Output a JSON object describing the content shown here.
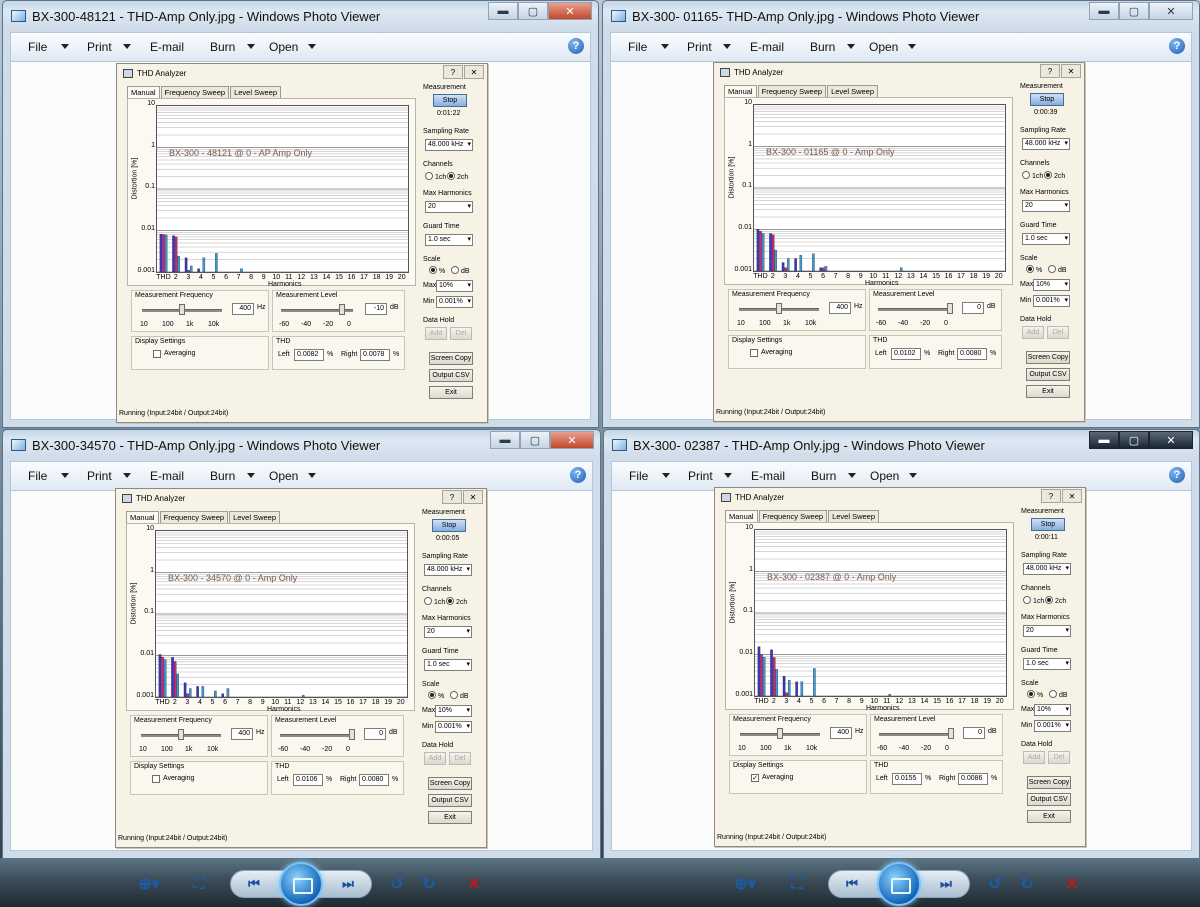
{
  "menu": {
    "file": "File",
    "print": "Print",
    "email": "E-mail",
    "burn": "Burn",
    "open": "Open",
    "help_icon": "?"
  },
  "caption_glyphs": {
    "minimize": "▬",
    "maximize": "▢",
    "close": "✕"
  },
  "dialog": {
    "title": "THD Analyzer",
    "title_buttons": [
      "?",
      "✕"
    ],
    "tabs": [
      "Manual",
      "Frequency Sweep",
      "Level Sweep"
    ],
    "y_axis_label": "Distortion [%]",
    "y_ticks": [
      "10",
      "1",
      "0.1",
      "0.01",
      "0.001"
    ],
    "x_ticks": [
      "THD",
      "2",
      "3",
      "4",
      "5",
      "6",
      "7",
      "8",
      "9",
      "10",
      "11",
      "12",
      "13",
      "14",
      "15",
      "16",
      "17",
      "18",
      "19",
      "20"
    ],
    "x_axis_label": "Harmonics",
    "measurement_frequency_label": "Measurement Frequency",
    "frequency_ticks": [
      "10",
      "100",
      "1k",
      "10k"
    ],
    "frequency_unit": "Hz",
    "measurement_level_label": "Measurement Level",
    "level_ticks": [
      "-60",
      "-40",
      "-20",
      "0"
    ],
    "level_unit": "dB",
    "display_settings_label": "Display Settings",
    "averaging_label": "Averaging",
    "thd_label": "THD",
    "left_label": "Left",
    "right_label": "Right",
    "percent": "%",
    "measurement_label": "Measurement",
    "stop_label": "Stop",
    "sampling_rate_label": "Sampling Rate",
    "sampling_rate_value": "48.000 kHz",
    "channels_label": "Channels",
    "ch1_label": "1ch",
    "ch2_label": "2ch",
    "max_harmonics_label": "Max Harmonics",
    "max_harmonics_value": "20",
    "guard_time_label": "Guard Time",
    "guard_time_value": "1.0 sec",
    "scale_label": "Scale",
    "scale_pct": "%",
    "scale_db": "dB",
    "max_label": "Max",
    "max_value": "10%",
    "min_label": "Min",
    "min_value": "0.001%",
    "data_hold_label": "Data Hold",
    "add_label": "Add",
    "del_label": "Del",
    "screen_copy_label": "Screen Copy",
    "output_csv_label": "Output CSV",
    "exit_label": "Exit",
    "status": "Running (Input:24bit / Output:24bit)"
  },
  "windows": [
    {
      "title": "BX-300-48121 - THD-Amp Only.jpg - Windows Photo Viewer",
      "timer": "0:01:22",
      "annotation": "BX-300 - 48121 @ 0 - AP Amp Only",
      "frequency_value": "400",
      "level_value": "-10",
      "level_knob": 0.85,
      "thd_left": "0.0082",
      "thd_right": "0.0078",
      "averaging_checked": false,
      "chart_data": {
        "type": "bar",
        "categories": [
          "THD",
          "2",
          "3",
          "4",
          "5",
          "6",
          "7",
          "8",
          "9",
          "10",
          "11",
          "12",
          "13",
          "14",
          "15",
          "16",
          "17",
          "18",
          "19",
          "20"
        ],
        "series": [
          {
            "color": "#3a35c8",
            "values": [
              0.0082,
              0.0075,
              0.0022,
              0.0012,
              0,
              0,
              0,
              0,
              0,
              0,
              0,
              0,
              0,
              0,
              0,
              0,
              0,
              0,
              0,
              0
            ]
          },
          {
            "color": "#c8277a",
            "values": [
              0.008,
              0.007,
              0.0011,
              0,
              0,
              0,
              0,
              0,
              0,
              0,
              0,
              0,
              0,
              0,
              0,
              0,
              0,
              0,
              0,
              0
            ]
          },
          {
            "color": "#3a9ad8",
            "values": [
              0.0078,
              0.0024,
              0.0014,
              0.0022,
              0.0028,
              0,
              0.0012,
              0,
              0,
              0,
              0,
              0,
              0,
              0,
              0,
              0,
              0,
              0,
              0,
              0
            ]
          }
        ],
        "ylim": [
          0.001,
          10
        ],
        "yscale": "log"
      }
    },
    {
      "title": "BX-300- 01165- THD-Amp Only.jpg - Windows Photo Viewer",
      "timer": "0:00:39",
      "annotation": "BX-300 - 01165 @ 0 - Amp Only",
      "frequency_value": "400",
      "level_value": "0",
      "level_knob": 1.0,
      "thd_left": "0.0102",
      "thd_right": "0.0080",
      "averaging_checked": false,
      "chart_data": {
        "type": "bar",
        "categories": [
          "THD",
          "2",
          "3",
          "4",
          "5",
          "6",
          "7",
          "8",
          "9",
          "10",
          "11",
          "12",
          "13",
          "14",
          "15",
          "16",
          "17",
          "18",
          "19",
          "20"
        ],
        "series": [
          {
            "color": "#3a35c8",
            "values": [
              0.0102,
              0.008,
              0.0016,
              0.002,
              0,
              0.0012,
              0,
              0,
              0,
              0,
              0,
              0,
              0,
              0,
              0,
              0,
              0,
              0,
              0,
              0
            ]
          },
          {
            "color": "#c8277a",
            "values": [
              0.009,
              0.0075,
              0.0012,
              0,
              0,
              0.0012,
              0,
              0,
              0,
              0,
              0,
              0,
              0,
              0,
              0,
              0,
              0,
              0,
              0,
              0
            ]
          },
          {
            "color": "#3a9ad8",
            "values": [
              0.008,
              0.0032,
              0.002,
              0.0024,
              0.0026,
              0.0013,
              0,
              0,
              0,
              0,
              0,
              0.0012,
              0,
              0,
              0,
              0,
              0,
              0,
              0,
              0
            ]
          }
        ],
        "ylim": [
          0.001,
          10
        ],
        "yscale": "log"
      }
    },
    {
      "title": "BX-300-34570 - THD-Amp Only.jpg - Windows Photo Viewer",
      "timer": "0:00:05",
      "annotation": "BX-300 - 34570 @ 0 - Amp Only",
      "frequency_value": "400",
      "level_value": "0",
      "level_knob": 1.0,
      "thd_left": "0.0106",
      "thd_right": "0.0080",
      "averaging_checked": false,
      "chart_data": {
        "type": "bar",
        "categories": [
          "THD",
          "2",
          "3",
          "4",
          "5",
          "6",
          "7",
          "8",
          "9",
          "10",
          "11",
          "12",
          "13",
          "14",
          "15",
          "16",
          "17",
          "18",
          "19",
          "20"
        ],
        "series": [
          {
            "color": "#3a35c8",
            "values": [
              0.0106,
              0.009,
              0.0022,
              0.0018,
              0,
              0.0012,
              0,
              0,
              0,
              0,
              0,
              0,
              0,
              0,
              0,
              0,
              0,
              0,
              0,
              0
            ]
          },
          {
            "color": "#c8277a",
            "values": [
              0.0092,
              0.0072,
              0.0012,
              0,
              0,
              0,
              0,
              0,
              0,
              0,
              0,
              0,
              0,
              0,
              0,
              0,
              0,
              0,
              0,
              0
            ]
          },
          {
            "color": "#3a9ad8",
            "values": [
              0.008,
              0.0036,
              0.0016,
              0.0018,
              0.0014,
              0.0016,
              0,
              0,
              0,
              0,
              0,
              0.0011,
              0,
              0,
              0,
              0,
              0,
              0,
              0,
              0
            ]
          }
        ],
        "ylim": [
          0.001,
          10
        ],
        "yscale": "log"
      }
    },
    {
      "title": "BX-300- 02387 - THD-Amp Only.jpg - Windows Photo Viewer",
      "timer": "0:00:11",
      "annotation": "BX-300 - 02387 @ 0 - Amp Only",
      "frequency_value": "400",
      "level_value": "0",
      "level_knob": 1.0,
      "thd_left": "0.0155",
      "thd_right": "0.0086",
      "averaging_checked": true,
      "chart_data": {
        "type": "bar",
        "categories": [
          "THD",
          "2",
          "3",
          "4",
          "5",
          "6",
          "7",
          "8",
          "9",
          "10",
          "11",
          "12",
          "13",
          "14",
          "15",
          "16",
          "17",
          "18",
          "19",
          "20"
        ],
        "series": [
          {
            "color": "#3a35c8",
            "values": [
              0.0155,
              0.013,
              0.003,
              0.0022,
              0,
              0.001,
              0,
              0,
              0,
              0,
              0,
              0,
              0,
              0,
              0,
              0,
              0,
              0,
              0,
              0
            ]
          },
          {
            "color": "#c8277a",
            "values": [
              0.01,
              0.0085,
              0.0012,
              0,
              0,
              0,
              0,
              0,
              0,
              0,
              0,
              0,
              0,
              0,
              0,
              0,
              0,
              0,
              0,
              0
            ]
          },
          {
            "color": "#3a9ad8",
            "values": [
              0.0086,
              0.0044,
              0.0024,
              0.0022,
              0.0046,
              0,
              0,
              0,
              0,
              0,
              0.0011,
              0.001,
              0,
              0,
              0,
              0,
              0,
              0,
              0,
              0
            ]
          }
        ],
        "ylim": [
          0.001,
          10
        ],
        "yscale": "log"
      }
    }
  ],
  "toolbar": {
    "zoom_icon": "⊕▾",
    "actual_size_icon": "⛶",
    "prev_icon": "⏮",
    "next_icon": "⏭",
    "rotate_ccw_icon": "↺",
    "rotate_cw_icon": "↻",
    "delete_icon": "✕"
  }
}
